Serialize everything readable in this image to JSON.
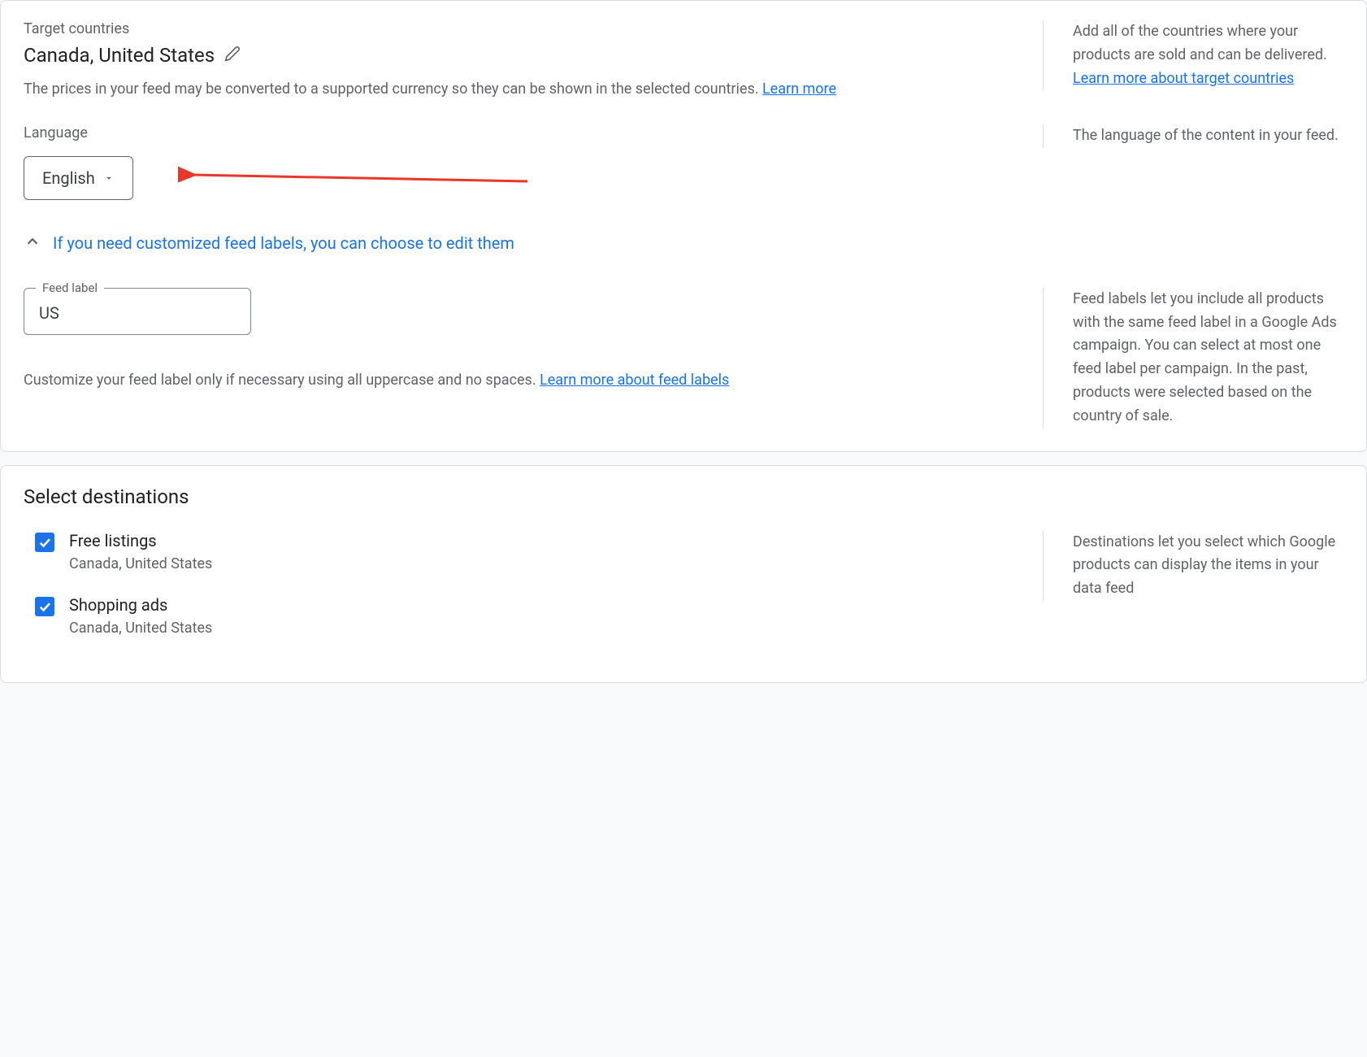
{
  "target_countries": {
    "label": "Target countries",
    "value": "Canada, United States",
    "help_text": "The prices in your feed may be converted to a supported currency so they can be shown in the selected countries. ",
    "learn_more": "Learn more",
    "side_help": "Add all of the countries where your products are sold and can be delivered. ",
    "side_link": "Learn more about target countries"
  },
  "language": {
    "label": "Language",
    "value": "English",
    "side_help": "The language of the content in your feed."
  },
  "feed_labels_expand": {
    "text": "If you need customized feed labels, you can choose to edit them"
  },
  "feed_label": {
    "label": "Feed label",
    "value": "US",
    "help_prefix": "Customize your feed label only if necessary using all uppercase and no spaces. ",
    "help_link": "Learn more about feed labels",
    "side_help": "Feed labels let you include all products with the same feed label in a Google Ads campaign. You can select at most one feed label per campaign. In the past, products were selected based on the country of sale."
  },
  "destinations": {
    "title": "Select destinations",
    "side_help": "Destinations let you select which Google products can display the items in your data feed",
    "items": [
      {
        "label": "Free listings",
        "sub": "Canada, United States",
        "checked": true
      },
      {
        "label": "Shopping ads",
        "sub": "Canada, United States",
        "checked": true
      }
    ]
  }
}
